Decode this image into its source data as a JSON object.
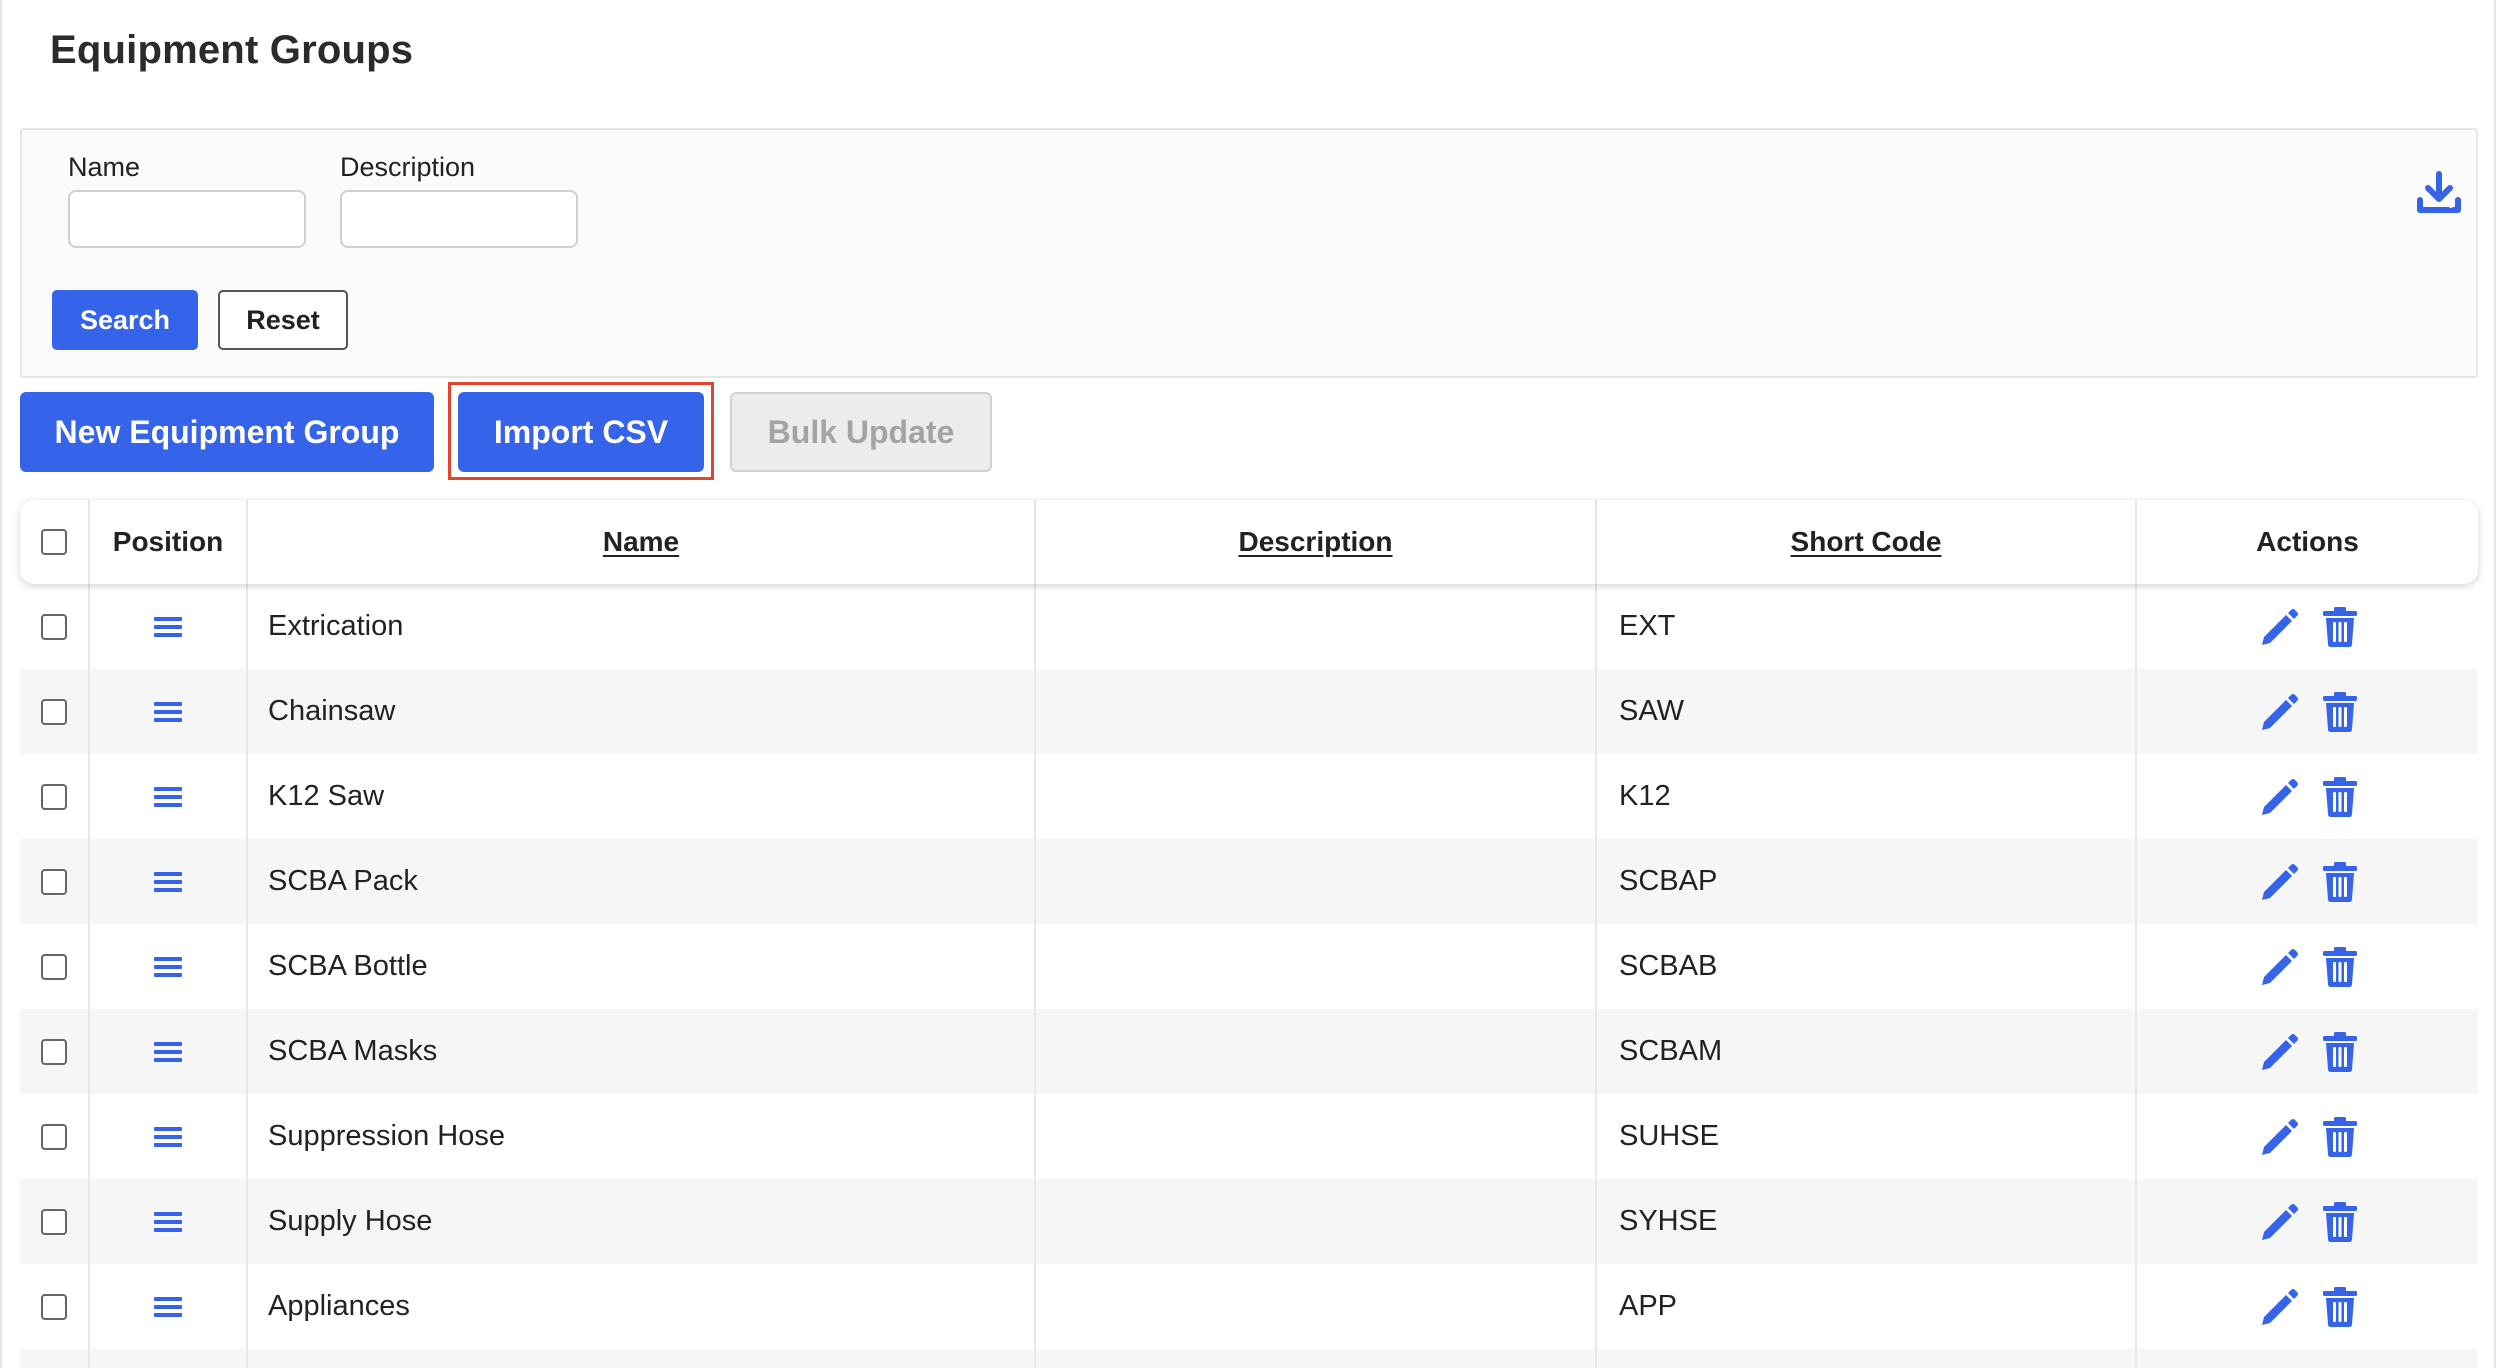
{
  "page": {
    "title": "Equipment Groups"
  },
  "filters": {
    "name_label": "Name",
    "name_value": "",
    "description_label": "Description",
    "description_value": "",
    "search_label": "Search",
    "reset_label": "Reset",
    "download_icon": "download-icon"
  },
  "toolbar": {
    "new_label": "New Equipment Group",
    "import_label": "Import CSV",
    "bulk_label": "Bulk Update"
  },
  "table": {
    "columns": {
      "position": "Position",
      "name": "Name",
      "description": "Description",
      "short_code": "Short Code",
      "actions": "Actions"
    },
    "rows": [
      {
        "name": "Extrication",
        "description": "",
        "short_code": "EXT"
      },
      {
        "name": "Chainsaw",
        "description": "",
        "short_code": "SAW"
      },
      {
        "name": "K12 Saw",
        "description": "",
        "short_code": "K12"
      },
      {
        "name": "SCBA Pack",
        "description": "",
        "short_code": "SCBAP"
      },
      {
        "name": "SCBA Bottle",
        "description": "",
        "short_code": "SCBAB"
      },
      {
        "name": "SCBA Masks",
        "description": "",
        "short_code": "SCBAM"
      },
      {
        "name": "Suppression Hose",
        "description": "",
        "short_code": "SUHSE"
      },
      {
        "name": "Supply Hose",
        "description": "",
        "short_code": "SYHSE"
      },
      {
        "name": "Appliances",
        "description": "",
        "short_code": "APP"
      },
      {
        "name": "",
        "description": "",
        "short_code": ""
      }
    ]
  },
  "colors": {
    "primary": "#3563e9",
    "highlight": "#e0452f",
    "row_alt": "#f6f6f6"
  }
}
